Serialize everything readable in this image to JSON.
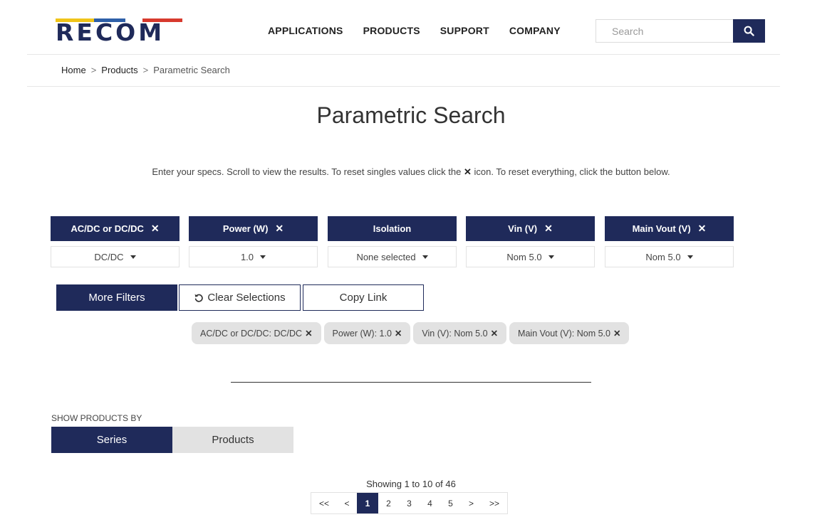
{
  "header": {
    "logo_text": "RECOM",
    "brand_colors": [
      "#f0c419",
      "#2e5fa8",
      "#2e5fa8",
      "#d73a2e"
    ],
    "nav": [
      "APPLICATIONS",
      "PRODUCTS",
      "SUPPORT",
      "COMPANY"
    ],
    "search_placeholder": "Search",
    "search_icon": "search-icon"
  },
  "breadcrumb": {
    "items": [
      "Home",
      "Products",
      "Parametric Search"
    ],
    "separator": ">"
  },
  "page_title": "Parametric Search",
  "instructions": {
    "before": "Enter your specs. Scroll to view the results. To reset singles values click the",
    "x": "✕",
    "after": "icon. To reset everything, click the button below."
  },
  "filters": [
    {
      "label": "AC/DC or DC/DC",
      "clear": "✕",
      "value": "DC/DC"
    },
    {
      "label": "Power (W)",
      "clear": "✕",
      "value": "1.0"
    },
    {
      "label": "Isolation",
      "clear": "",
      "value": "None selected"
    },
    {
      "label": "Vin (V)",
      "clear": "✕",
      "value": "Nom 5.0"
    },
    {
      "label": "Main Vout (V)",
      "clear": "✕",
      "value": "Nom 5.0"
    }
  ],
  "actions": {
    "more_filters": "More Filters",
    "clear_selections": "Clear Selections",
    "copy_link": "Copy Link"
  },
  "chips": [
    {
      "label": "AC/DC or DC/DC: DC/DC",
      "x": "✕"
    },
    {
      "label": "Power (W): 1.0",
      "x": "✕"
    },
    {
      "label": "Vin (V): Nom 5.0",
      "x": "✕"
    },
    {
      "label": "Main Vout (V): Nom 5.0",
      "x": "✕"
    }
  ],
  "show_by": {
    "label": "SHOW PRODUCTS BY",
    "options": [
      "Series",
      "Products"
    ],
    "selected": "Series"
  },
  "results": {
    "showing": "Showing 1 to 10 of 46"
  },
  "pagination": {
    "items": [
      "<<",
      "<",
      "1",
      "2",
      "3",
      "4",
      "5",
      ">",
      ">>"
    ],
    "current": "1"
  },
  "colors": {
    "primary": "#1f2a5a",
    "chip_bg": "#e2e2e2"
  }
}
